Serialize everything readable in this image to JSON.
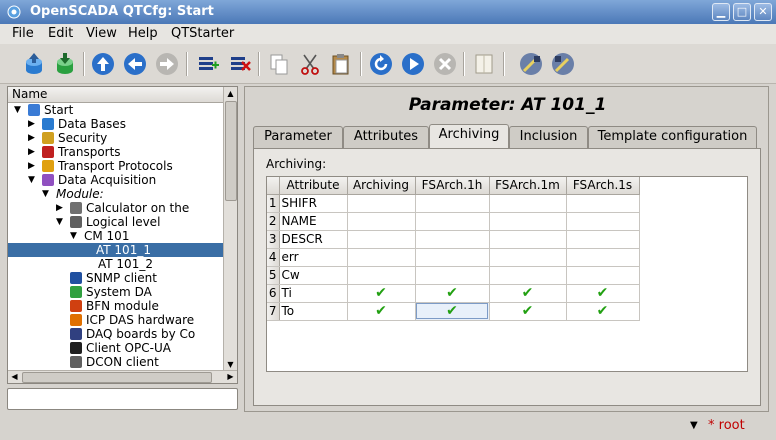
{
  "window": {
    "title": "OpenSCADA QTCfg: Start"
  },
  "menu": [
    "File",
    "Edit",
    "View",
    "Help",
    "QTStarter"
  ],
  "toolbar_icons": [
    "db-load-icon",
    "db-save-icon",
    "up-icon",
    "back-icon",
    "forward-icon",
    "add-item-icon",
    "delete-item-icon",
    "copy-icon",
    "cut-icon",
    "paste-icon",
    "refresh-icon",
    "start-icon",
    "stop-icon",
    "manual-icon",
    "tool1-icon",
    "tool2-icon"
  ],
  "tree": {
    "header": "Name",
    "items": [
      {
        "label": "Start",
        "level": 0,
        "expanded": true,
        "icon": "start-icon"
      },
      {
        "label": "Data Bases",
        "level": 1,
        "expanded": false,
        "icon": "database-icon"
      },
      {
        "label": "Security",
        "level": 1,
        "expanded": false,
        "icon": "security-icon"
      },
      {
        "label": "Transports",
        "level": 1,
        "expanded": false,
        "icon": "transport-icon"
      },
      {
        "label": "Transport Protocols",
        "level": 1,
        "expanded": false,
        "icon": "protocol-icon"
      },
      {
        "label": "Data Acquisition",
        "level": 1,
        "expanded": true,
        "icon": "daq-icon"
      },
      {
        "label": "Module:",
        "level": 2,
        "expanded": true,
        "icon": "",
        "italic": true
      },
      {
        "label": "Calculator on the ",
        "level": 3,
        "expanded": false,
        "icon": "calculator-icon"
      },
      {
        "label": "Logical level",
        "level": 3,
        "expanded": true,
        "icon": "logic-icon"
      },
      {
        "label": "CM 101",
        "level": 4,
        "expanded": true,
        "icon": ""
      },
      {
        "label": "AT 101_1",
        "level": 5,
        "expanded": null,
        "icon": "",
        "selected": true
      },
      {
        "label": "AT 101_2",
        "level": 5,
        "expanded": null,
        "icon": ""
      },
      {
        "label": "SNMP client",
        "level": 3,
        "expanded": null,
        "icon": "snmp-icon"
      },
      {
        "label": "System DA",
        "level": 3,
        "expanded": null,
        "icon": "system-icon"
      },
      {
        "label": "BFN module",
        "level": 3,
        "expanded": null,
        "icon": "bfn-icon"
      },
      {
        "label": "ICP DAS hardware",
        "level": 3,
        "expanded": null,
        "icon": "icpdas-icon"
      },
      {
        "label": "DAQ boards by Co",
        "level": 3,
        "expanded": null,
        "icon": "daqboard-icon"
      },
      {
        "label": "Client OPC-UA",
        "level": 3,
        "expanded": null,
        "icon": "opcua-icon"
      },
      {
        "label": "DCON client",
        "level": 3,
        "expanded": null,
        "icon": "dcon-icon"
      }
    ]
  },
  "panel": {
    "title": "Parameter: AT 101_1",
    "tabs": [
      "Parameter",
      "Attributes",
      "Archiving",
      "Inclusion",
      "Template configuration"
    ],
    "active_tab": 2,
    "archiving_label": "Archiving:",
    "columns": [
      "Attribute",
      "Archiving",
      "FSArch.1h",
      "FSArch.1m",
      "FSArch.1s"
    ],
    "rows": [
      {
        "num": "1",
        "attr": "SHIFR",
        "checks": [
          false,
          false,
          false,
          false
        ]
      },
      {
        "num": "2",
        "attr": "NAME",
        "checks": [
          false,
          false,
          false,
          false
        ]
      },
      {
        "num": "3",
        "attr": "DESCR",
        "checks": [
          false,
          false,
          false,
          false
        ]
      },
      {
        "num": "4",
        "attr": "err",
        "checks": [
          false,
          false,
          false,
          false
        ]
      },
      {
        "num": "5",
        "attr": "Cw",
        "checks": [
          false,
          false,
          false,
          false
        ]
      },
      {
        "num": "6",
        "attr": "Ti",
        "checks": [
          true,
          true,
          true,
          true
        ]
      },
      {
        "num": "7",
        "attr": "To",
        "checks": [
          true,
          true,
          true,
          true
        ]
      }
    ],
    "check_glyph": "✔"
  },
  "status": {
    "user": "* root",
    "dropmark": "▼"
  }
}
